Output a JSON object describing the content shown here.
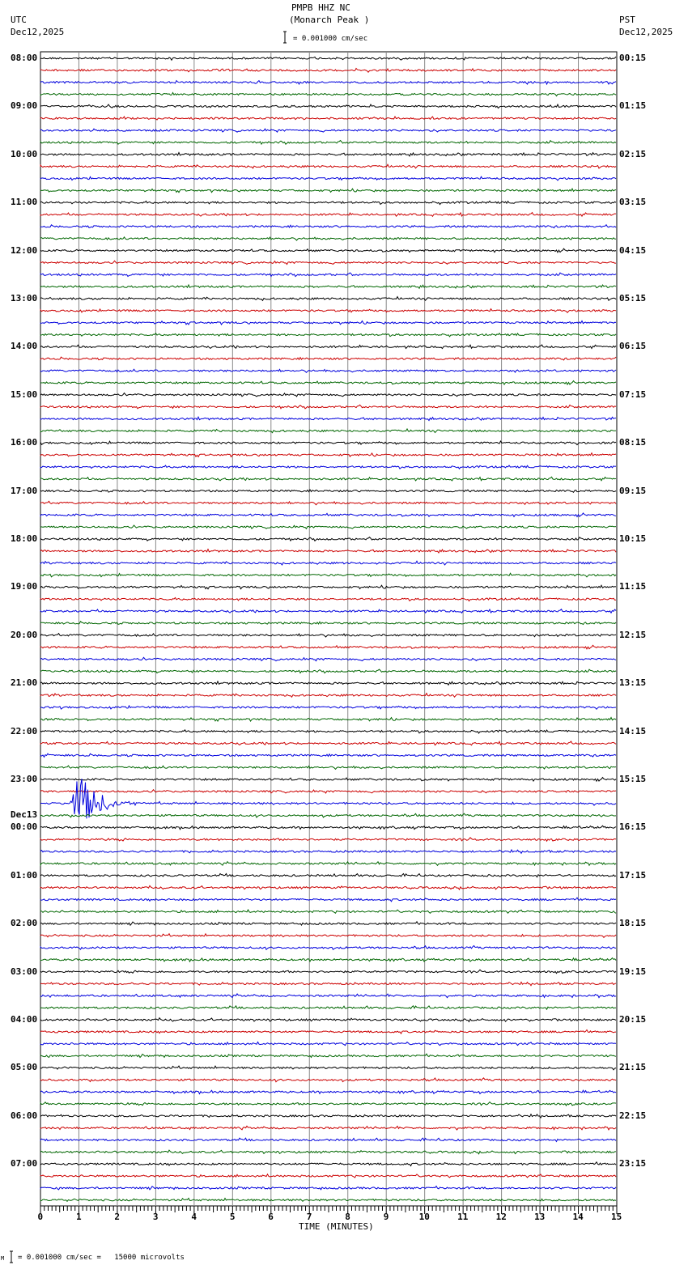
{
  "chart_data": {
    "type": "helicorder",
    "title": "PMPB HHZ NC",
    "subtitle": "(Monarch Peak )",
    "left_timezone": "UTC",
    "left_date": "Dec12,2025",
    "right_timezone": "PST",
    "right_date": "Dec12,2025",
    "scale_label": "= 0.001000 cm/sec",
    "footer_scale": "= 0.001000 cm/sec =   15000 microvolts",
    "footer_mark": "M",
    "xlabel": "TIME (MINUTES)",
    "xlim": [
      0,
      15
    ],
    "x_ticks": [
      "0",
      "1",
      "2",
      "3",
      "4",
      "5",
      "6",
      "7",
      "8",
      "9",
      "10",
      "11",
      "12",
      "13",
      "14",
      "15"
    ],
    "minutes_per_line": 15,
    "line_count": 96,
    "trace_colors": [
      "#000000",
      "#cc0000",
      "#0000dd",
      "#006600"
    ],
    "left_labels": [
      "08:00",
      "09:00",
      "10:00",
      "11:00",
      "12:00",
      "13:00",
      "14:00",
      "15:00",
      "16:00",
      "17:00",
      "18:00",
      "19:00",
      "20:00",
      "21:00",
      "22:00",
      "23:00",
      "00:00",
      "01:00",
      "02:00",
      "03:00",
      "04:00",
      "05:00",
      "06:00",
      "07:00"
    ],
    "date_change_label": "Dec13",
    "date_change_hour_index": 16,
    "right_labels": [
      "00:15",
      "01:15",
      "02:15",
      "03:15",
      "04:15",
      "05:15",
      "06:15",
      "07:15",
      "08:15",
      "09:15",
      "10:15",
      "11:15",
      "12:15",
      "13:15",
      "14:15",
      "15:15",
      "16:15",
      "17:15",
      "18:15",
      "19:15",
      "20:15",
      "21:15",
      "22:15",
      "23:15"
    ],
    "event": {
      "line_index": 62,
      "start_minute": 0.75,
      "peak_minute": 1.0,
      "end_minute": 3.0,
      "peak_amplitude_lines": 2.5
    }
  }
}
